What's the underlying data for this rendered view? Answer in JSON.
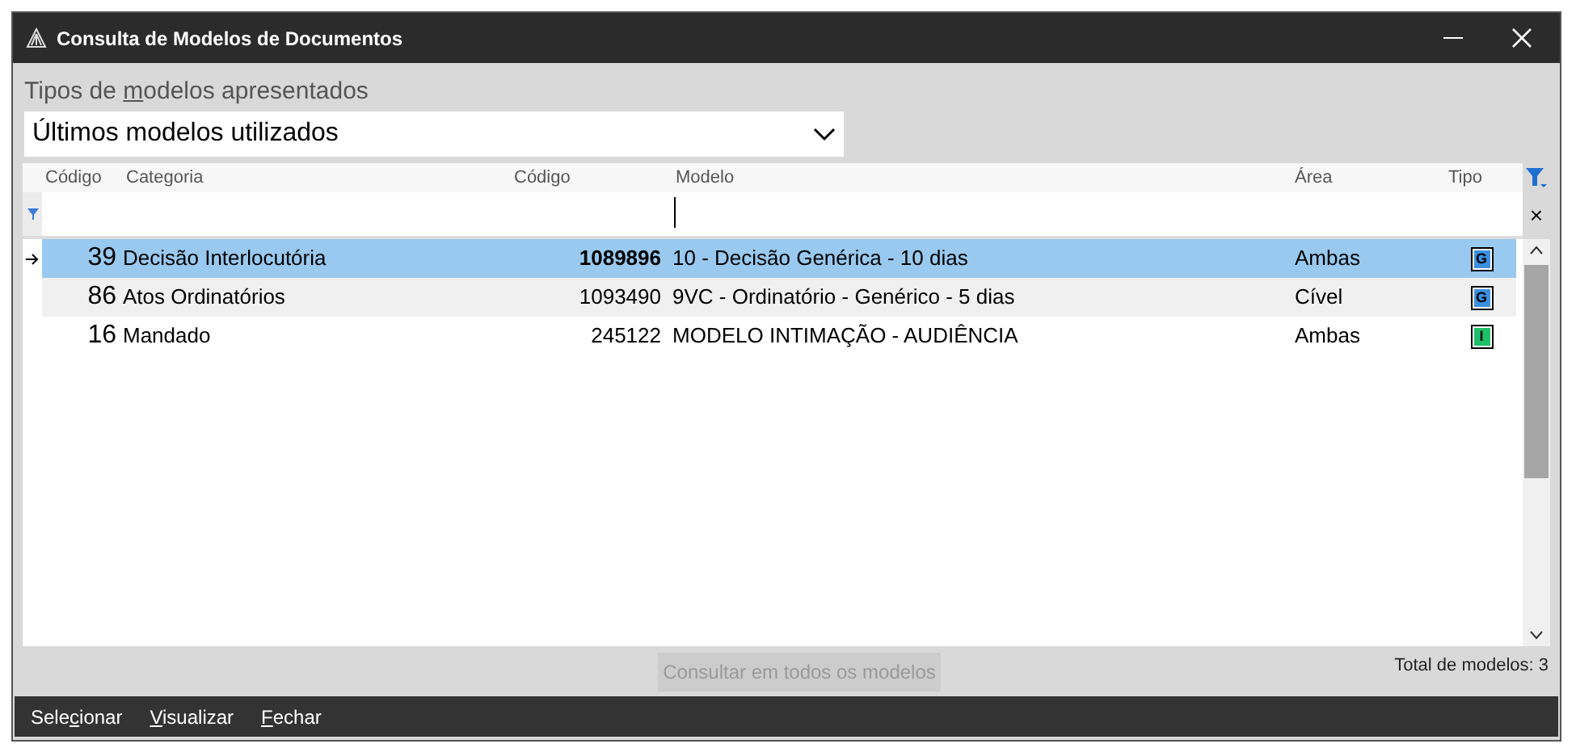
{
  "window": {
    "title": "Consulta de Modelos de Documentos"
  },
  "model_type": {
    "label": {
      "before": "Tipos de ",
      "mnemonic": "m",
      "after": "odelos apresentados"
    },
    "value": "Últimos modelos utilizados"
  },
  "table": {
    "columns": [
      "Código",
      "Categoria",
      "Código",
      "Modelo",
      "Área",
      "Tipo"
    ],
    "rows": [
      {
        "category_code": "39",
        "category": "Decisão Interlocutória",
        "model_code": "1089896",
        "model": "10 - Decisão Genérica - 10 dias",
        "area": "Ambas",
        "type": "G",
        "color": "#3d8fe0",
        "selected": true
      },
      {
        "category_code": "86",
        "category": "Atos Ordinatórios",
        "model_code": "1093490",
        "model": "9VC - Ordinatório - Genérico - 5 dias",
        "area": "Cível",
        "type": "G",
        "color": "#3d8fe0",
        "selected": false
      },
      {
        "category_code": "16",
        "category": "Mandado",
        "model_code": "245122",
        "model": "MODELO INTIMAÇÃO - AUDIÊNCIA",
        "area": "Ambas",
        "type": "I",
        "color": "#1fbf6a",
        "selected": false
      }
    ]
  },
  "clear_filter": "×",
  "search_all_button": {
    "label": "Consultar em todos os modelos",
    "disabled": true
  },
  "total": "Total de modelos: 3",
  "footer_buttons": [
    {
      "before": "Sele",
      "mnemonic": "c",
      "after": "ionar"
    },
    {
      "mnemonic": "V",
      "after": "isualizar"
    },
    {
      "mnemonic": "F",
      "after": "echar"
    }
  ]
}
